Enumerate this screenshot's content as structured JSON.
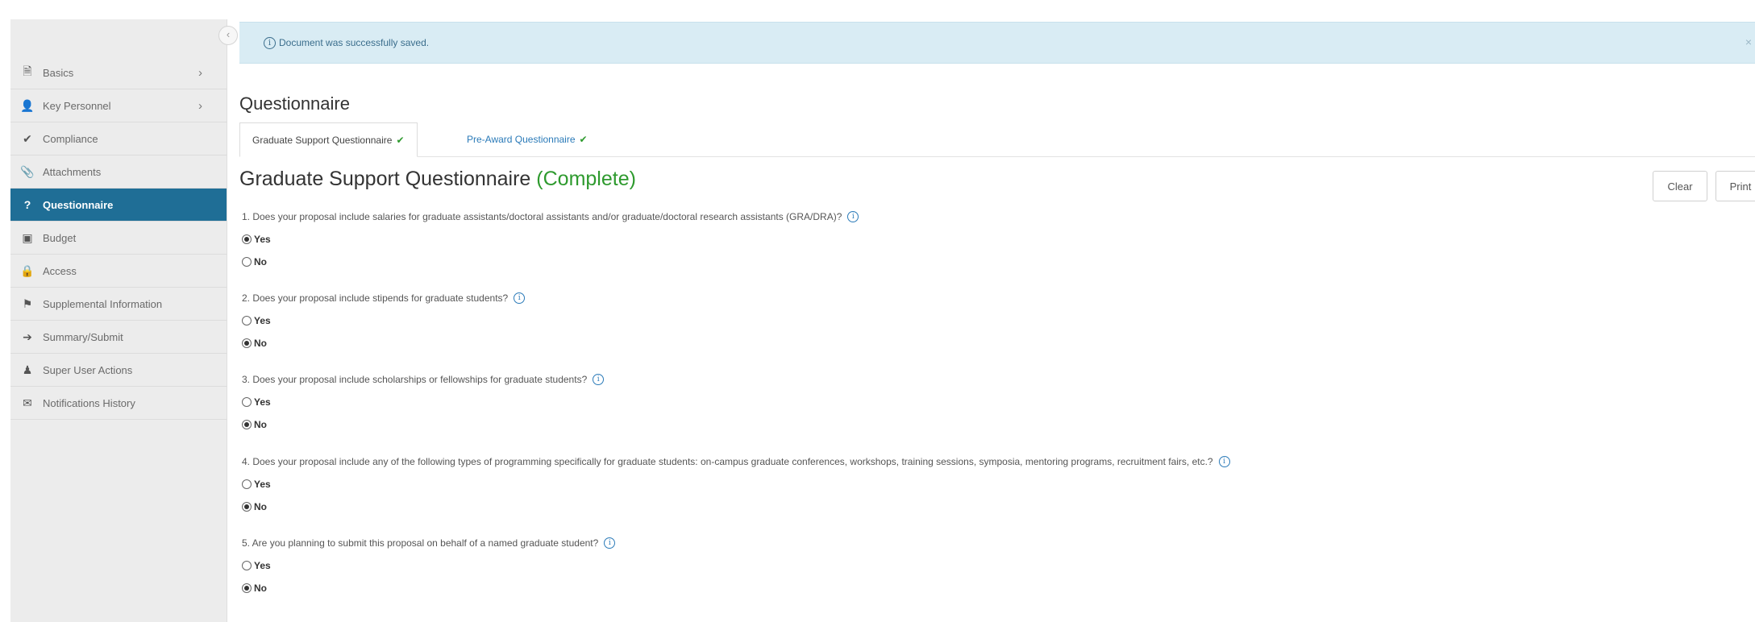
{
  "sidebar": {
    "collapse_icon": "‹",
    "items": [
      {
        "label": "Basics",
        "icon": "document-icon",
        "glyph": "🗎",
        "has_chevron": true,
        "active": false
      },
      {
        "label": "Key Personnel",
        "icon": "person-icon",
        "glyph": "👤",
        "has_chevron": true,
        "active": false
      },
      {
        "label": "Compliance",
        "icon": "check-icon",
        "glyph": "✔",
        "has_chevron": false,
        "active": false
      },
      {
        "label": "Attachments",
        "icon": "paperclip-icon",
        "glyph": "📎",
        "has_chevron": false,
        "active": false
      },
      {
        "label": "Questionnaire",
        "icon": "question-circle-icon",
        "glyph": "?",
        "has_chevron": false,
        "active": true
      },
      {
        "label": "Budget",
        "icon": "money-icon",
        "glyph": "▣",
        "has_chevron": false,
        "active": false
      },
      {
        "label": "Access",
        "icon": "lock-icon",
        "glyph": "🔒",
        "has_chevron": false,
        "active": false
      },
      {
        "label": "Supplemental Information",
        "icon": "sitemap-icon",
        "glyph": "⚑",
        "has_chevron": false,
        "active": false
      },
      {
        "label": "Summary/Submit",
        "icon": "sign-in-icon",
        "glyph": "➔",
        "has_chevron": false,
        "active": false
      },
      {
        "label": "Super User Actions",
        "icon": "user-admin-icon",
        "glyph": "♟",
        "has_chevron": false,
        "active": false
      },
      {
        "label": "Notifications History",
        "icon": "envelope-icon",
        "glyph": "✉",
        "has_chevron": false,
        "active": false
      }
    ],
    "chevron": "›"
  },
  "alert": {
    "message": "Document was successfully saved.",
    "close": "×"
  },
  "page": {
    "title": "Questionnaire"
  },
  "tabs": [
    {
      "label": "Graduate Support Questionnaire",
      "complete": true
    },
    {
      "label": "Pre-Award Questionnaire",
      "complete": true
    }
  ],
  "questionnaire": {
    "title": "Graduate Support Questionnaire",
    "status": "(Complete)",
    "clear_label": "Clear",
    "print_label": "Print",
    "yes_label": "Yes",
    "no_label": "No",
    "questions": [
      {
        "text": "1. Does your proposal include salaries for graduate assistants/doctoral assistants and/or graduate/doctoral research assistants (GRA/DRA)?",
        "answer": "Yes"
      },
      {
        "text": "2. Does your proposal include stipends for graduate students?",
        "answer": "No"
      },
      {
        "text": "3. Does your proposal include scholarships or fellowships for graduate students?",
        "answer": "No"
      },
      {
        "text": "4. Does your proposal include any of the following types of programming specifically for graduate students: on-campus graduate conferences, workshops, training sessions, symposia, mentoring programs, recruitment fairs, etc.?",
        "answer": "No"
      },
      {
        "text": "5. Are you planning to submit this proposal on behalf of a named graduate student?",
        "answer": "No"
      }
    ]
  },
  "colors": {
    "active_nav": "#1f6e96",
    "alert_bg": "#d9ecf4",
    "complete_green": "#2e9a2e",
    "link_blue": "#2a7ab8"
  }
}
